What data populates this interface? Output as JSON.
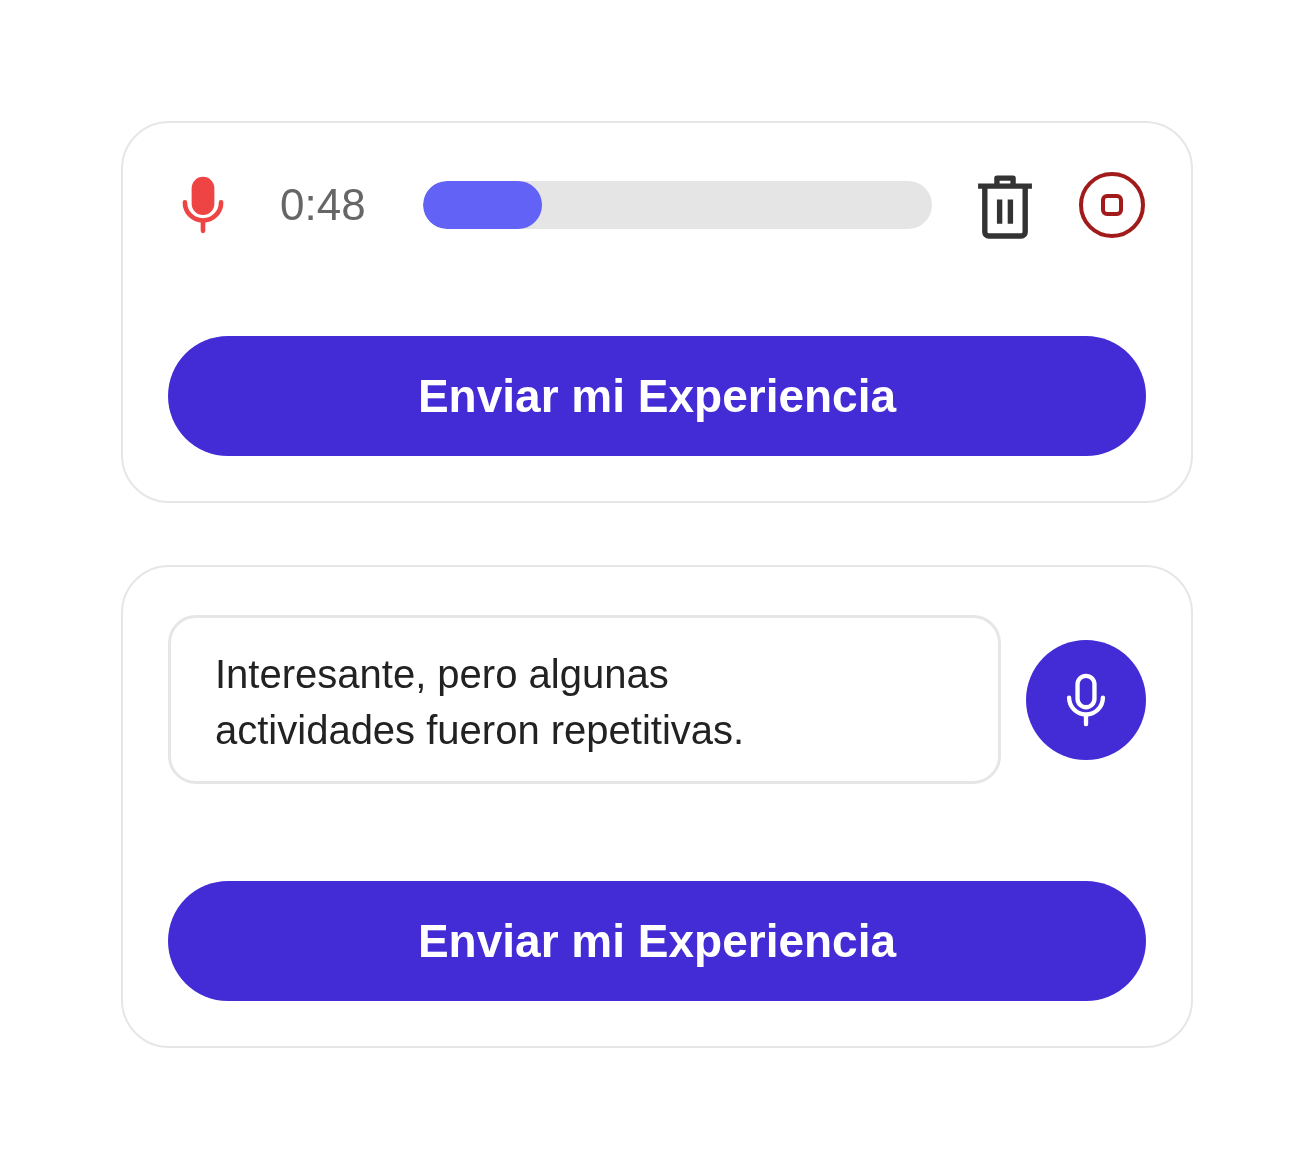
{
  "cards": [
    {
      "kind": "recorder",
      "time": "0:48",
      "level": 0.235,
      "button": "Enviar mi Experiencia"
    },
    {
      "kind": "text",
      "value": "Interesante, pero algunas actividades fueron repetitivas.",
      "button": "Enviar mi Experiencia"
    }
  ]
}
